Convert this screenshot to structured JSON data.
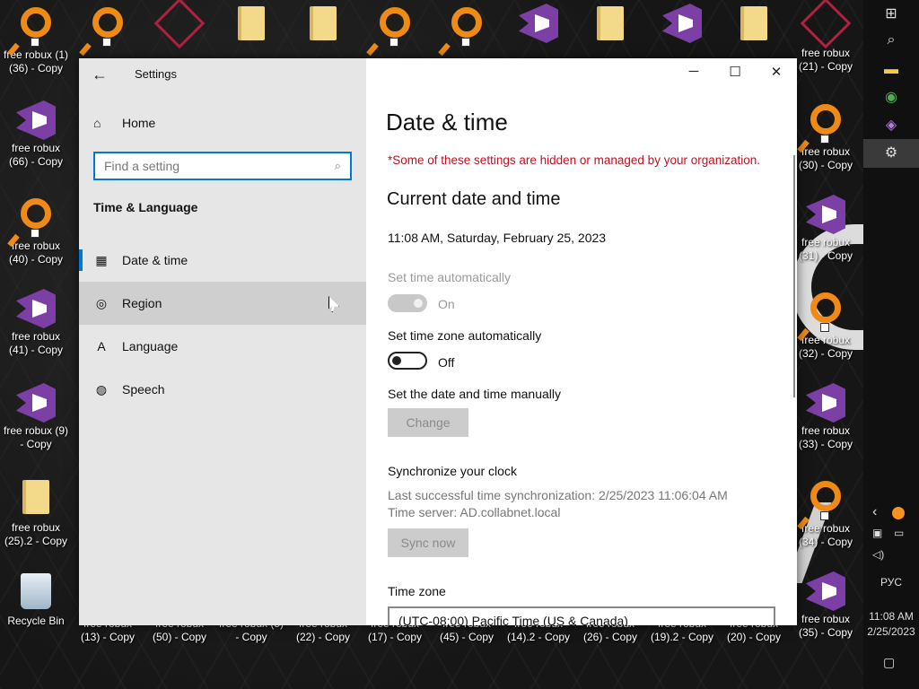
{
  "window": {
    "title": "Settings",
    "back_glyph": "←",
    "minimize_glyph": "─",
    "maximize_glyph": "☐",
    "close_glyph": "✕"
  },
  "sidebar": {
    "home_label": "Home",
    "search_placeholder": "Find a setting",
    "section_title": "Time & Language",
    "items": [
      {
        "label": "Date & time",
        "icon": "calendar-clock-icon"
      },
      {
        "label": "Region",
        "icon": "globe-icon"
      },
      {
        "label": "Language",
        "icon": "language-icon"
      },
      {
        "label": "Speech",
        "icon": "microphone-icon"
      }
    ]
  },
  "main": {
    "page_title": "Date & time",
    "warning": "*Some of these settings are hidden or managed by your organization.",
    "current_heading": "Current date and time",
    "current_datetime": "11:08 AM, Saturday, February 25, 2023",
    "set_time_auto_label": "Set time automatically",
    "set_time_auto_state": "On",
    "set_tz_auto_label": "Set time zone automatically",
    "set_tz_auto_state": "Off",
    "manual_label": "Set the date and time manually",
    "change_button": "Change",
    "sync_heading": "Synchronize your clock",
    "sync_last": "Last successful time synchronization: 2/25/2023 11:06:04 AM",
    "sync_server": "Time server: AD.collabnet.local",
    "sync_button": "Sync now",
    "timezone_label": "Time zone",
    "timezone_value": "(UTC-08:00) Pacific Time (US & Canada)"
  },
  "desktop": {
    "left_icons": [
      {
        "line1": "free robux",
        "line2": "(66) - Copy"
      },
      {
        "line1": "free robux",
        "line2": "(40) - Copy"
      },
      {
        "line1": "free robux",
        "line2": "(41) - Copy"
      },
      {
        "line1": "free robux (9)",
        "line2": "- Copy"
      },
      {
        "line1": "free robux",
        "line2": "(25).2 - Copy"
      },
      {
        "line1": "Recycle Bin",
        "line2": ""
      }
    ],
    "top_left_label": "free robux (1)",
    "top_left_label2": "(36) - Copy",
    "right_icons": [
      {
        "line1": "free robux",
        "line2": "(21) - Copy"
      },
      {
        "line1": "free robux",
        "line2": "(30) - Copy"
      },
      {
        "line1": "free robux",
        "line2": "(31) - Copy"
      },
      {
        "line1": "free robux",
        "line2": "(32) - Copy"
      },
      {
        "line1": "free robux",
        "line2": "(33) - Copy"
      },
      {
        "line1": "free robux",
        "line2": "(34) - Copy"
      },
      {
        "line1": "free robux",
        "line2": "(35) - Copy"
      }
    ],
    "bottom_icons": [
      {
        "line1": "free robux",
        "line2": "(13) - Copy"
      },
      {
        "line1": "free robux",
        "line2": "(50) - Copy"
      },
      {
        "line1": "free robux (5)",
        "line2": "- Copy"
      },
      {
        "line1": "free robux",
        "line2": "(22) - Copy"
      },
      {
        "line1": "free robux",
        "line2": "(17) - Copy"
      },
      {
        "line1": "free robux",
        "line2": "(45) - Copy"
      },
      {
        "line1": "free robux",
        "line2": "(14).2 - Copy"
      },
      {
        "line1": "free robux",
        "line2": "(26) - Copy"
      },
      {
        "line1": "free robux",
        "line2": "(19).2 - Copy"
      },
      {
        "line1": "free robux",
        "line2": "(20) - Copy"
      }
    ]
  },
  "taskbar": {
    "language": "РУС",
    "time": "11:08 AM",
    "date": "2/25/2023"
  },
  "colors": {
    "accent": "#0078d7",
    "warning": "#c50f1f"
  }
}
